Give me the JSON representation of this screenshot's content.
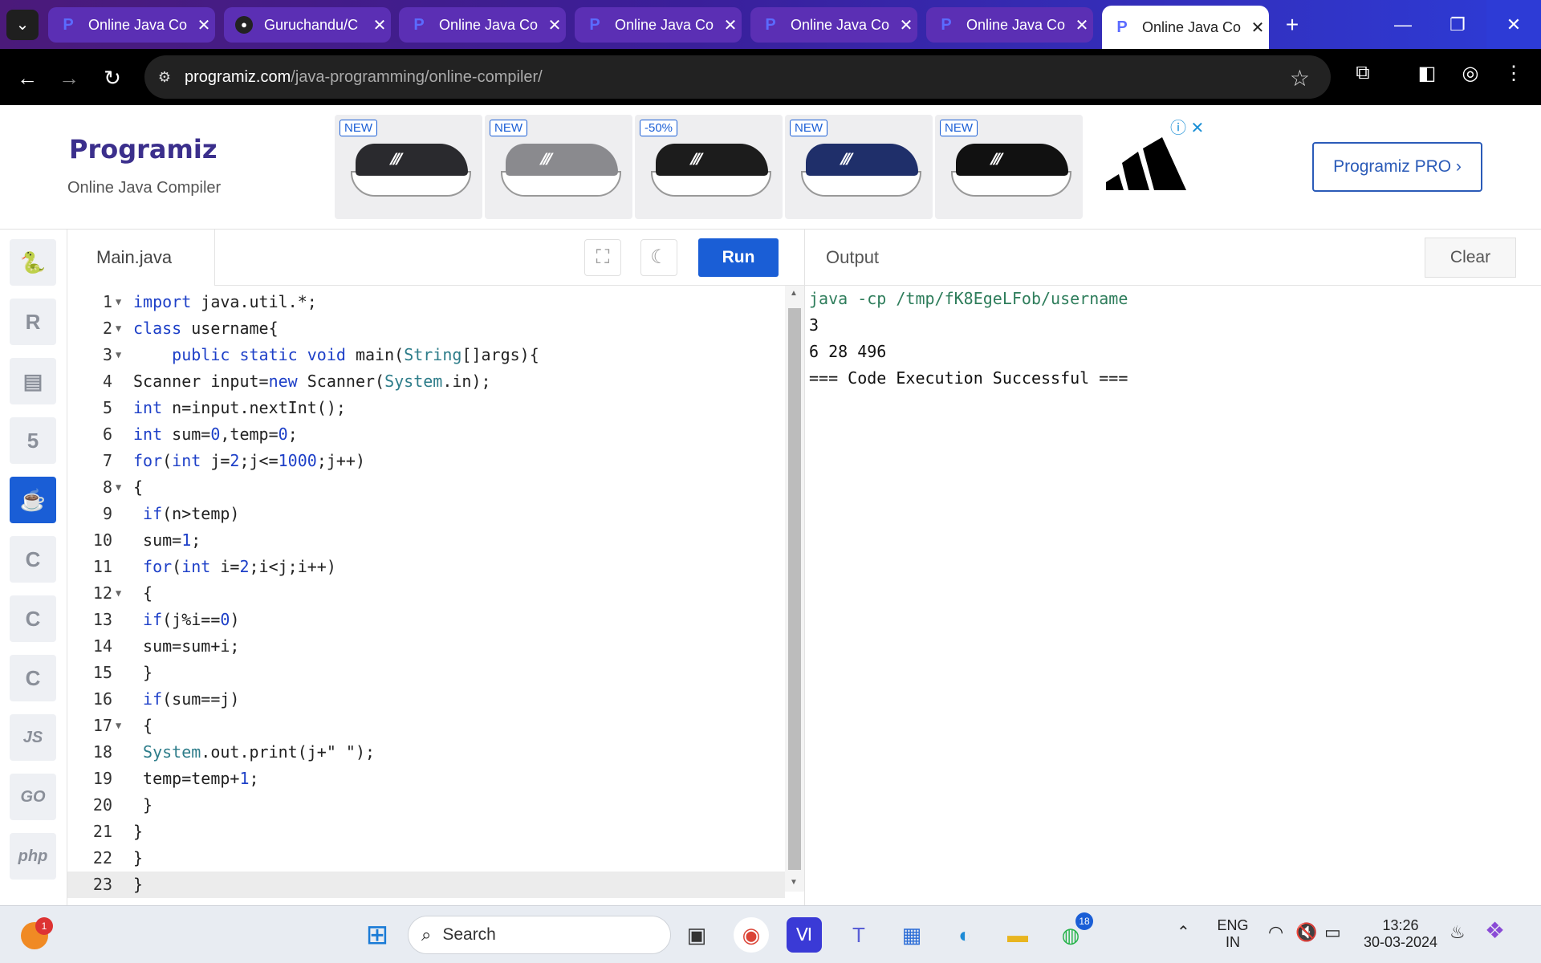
{
  "browser": {
    "tabs": [
      {
        "title": "Online Java Co",
        "favicon": "programiz-icon"
      },
      {
        "title": "Guruchandu/C",
        "favicon": "github-icon"
      },
      {
        "title": "Online Java Co",
        "favicon": "programiz-icon"
      },
      {
        "title": "Online Java Co",
        "favicon": "programiz-icon"
      },
      {
        "title": "Online Java Co",
        "favicon": "programiz-icon"
      },
      {
        "title": "Online Java Co",
        "favicon": "programiz-icon"
      },
      {
        "title": "Online Java Co",
        "favicon": "programiz-icon",
        "active": true
      }
    ],
    "url_host": "programiz.com",
    "url_path": "/java-programming/online-compiler/"
  },
  "header": {
    "logo": "Programiz",
    "subtitle": "Online Java Compiler",
    "pro_button": "Programiz PRO ›",
    "ad_badges": [
      "NEW",
      "NEW",
      "-50%",
      "NEW",
      "NEW"
    ]
  },
  "editor": {
    "filename": "Main.java",
    "run_label": "Run",
    "lines": [
      "import java.util.*;",
      "class username{",
      "    public static void main(String[]args){",
      "Scanner input=new Scanner(System.in);",
      "int n=input.nextInt();",
      "int sum=0,temp=0;",
      "for(int j=2;j<=1000;j++)",
      "{",
      " if(n>temp)",
      " sum=1;",
      " for(int i=2;i<j;i++)",
      " {",
      " if(j%i==0)",
      " sum=sum+i;",
      " }",
      " if(sum==j)",
      " {",
      " System.out.print(j+\" \");",
      " temp=temp+1;",
      " }",
      "}",
      "}",
      "}"
    ],
    "fold_lines": [
      1,
      2,
      3,
      8,
      12,
      17
    ]
  },
  "output": {
    "title": "Output",
    "clear_label": "Clear",
    "lines": [
      "java -cp /tmp/fK8EgeLFob/username",
      "3",
      "6 28 496",
      "=== Code Execution Successful ==="
    ]
  },
  "sidebar": {
    "languages": [
      {
        "name": "python-icon",
        "glyph": "🐍"
      },
      {
        "name": "r-icon",
        "glyph": "R"
      },
      {
        "name": "sql-icon",
        "glyph": "▤"
      },
      {
        "name": "html5-icon",
        "glyph": "5"
      },
      {
        "name": "java-icon",
        "glyph": "☕",
        "active": true
      },
      {
        "name": "c-icon",
        "glyph": "C"
      },
      {
        "name": "cpp-icon",
        "glyph": "C"
      },
      {
        "name": "csharp-icon",
        "glyph": "C"
      },
      {
        "name": "js-icon",
        "glyph": "JS"
      },
      {
        "name": "go-icon",
        "glyph": "GO"
      },
      {
        "name": "php-icon",
        "glyph": "php"
      }
    ]
  },
  "taskbar": {
    "search_label": "Search",
    "lang_top": "ENG",
    "lang_bottom": "IN",
    "time": "13:26",
    "date": "30-03-2024",
    "notif_count": "1",
    "whatsapp_count": "18"
  }
}
